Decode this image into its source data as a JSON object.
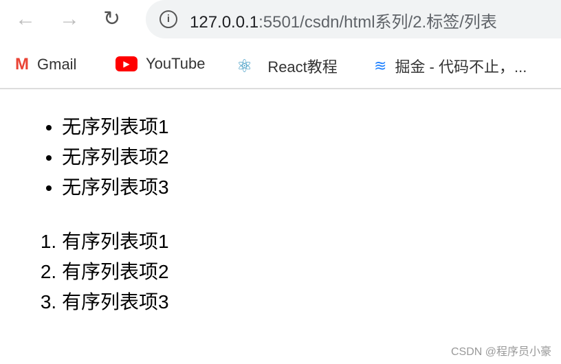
{
  "browser": {
    "url_host": "127.0.0.1",
    "url_rest": ":5501/csdn/html系列/2.标签/列表"
  },
  "bookmarks": [
    {
      "label": "Gmail",
      "icon": "gmail-icon"
    },
    {
      "label": "YouTube",
      "icon": "youtube-icon"
    },
    {
      "label": "React教程",
      "icon": "react-icon"
    },
    {
      "label": "掘金 - 代码不止，...",
      "icon": "juejin-icon"
    }
  ],
  "unordered": [
    "无序列表项1",
    "无序列表项2",
    "无序列表项3"
  ],
  "ordered": [
    "有序列表项1",
    "有序列表项2",
    "有序列表项3"
  ],
  "watermark": "CSDN @程序员小豪"
}
